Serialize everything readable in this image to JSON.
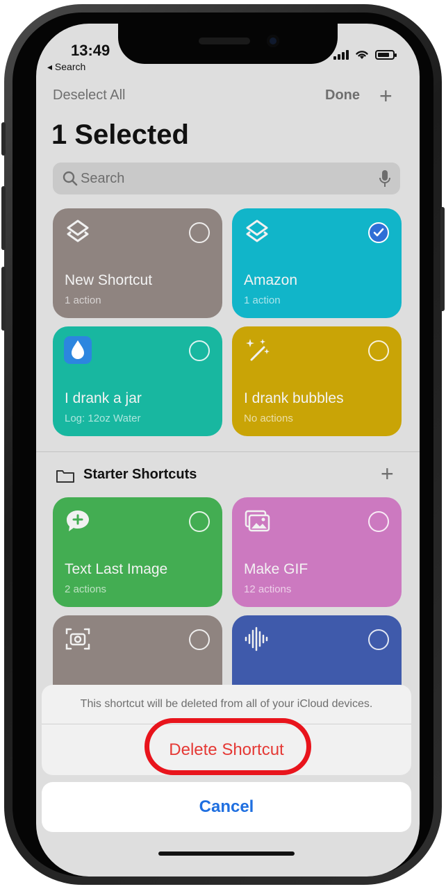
{
  "status": {
    "time": "13:49",
    "back_label": "◂ Search"
  },
  "nav": {
    "deselect_label": "Deselect All",
    "done_label": "Done",
    "add_label": "+"
  },
  "page_title": "1 Selected",
  "search": {
    "placeholder": "Search"
  },
  "shortcuts": [
    {
      "name": "New Shortcut",
      "subtitle": "1 action",
      "color": "#8f8480",
      "icon": "layers-icon",
      "selected": false
    },
    {
      "name": "Amazon",
      "subtitle": "1 action",
      "color": "#11b5c9",
      "icon": "layers-icon",
      "selected": true
    },
    {
      "name": "I drank a jar",
      "subtitle": "Log: 12oz Water",
      "color": "#18b7a0",
      "icon": "water-drop-icon",
      "selected": false
    },
    {
      "name": "I drank bubbles",
      "subtitle": "No actions",
      "color": "#c9a406",
      "icon": "magic-wand-icon",
      "selected": false
    }
  ],
  "starter_section": {
    "label": "Starter Shortcuts",
    "add_label": "+"
  },
  "starter_shortcuts": [
    {
      "name": "Text Last Image",
      "subtitle": "2 actions",
      "color": "#43ad52",
      "icon": "message-plus-icon"
    },
    {
      "name": "Make GIF",
      "subtitle": "12 actions",
      "color": "#cc79c0",
      "icon": "photos-icon"
    },
    {
      "name": "",
      "subtitle": "",
      "color": "#8f8480",
      "icon": "camera-scan-icon"
    },
    {
      "name": "",
      "subtitle": "",
      "color": "#3f5aab",
      "icon": "waveform-icon"
    }
  ],
  "action_sheet": {
    "message": "This shortcut will be deleted from all of your iCloud devices.",
    "delete_label": "Delete Shortcut",
    "cancel_label": "Cancel",
    "delete_color": "#e53935",
    "cancel_color": "#1f6fe0",
    "highlight_color": "#e8141c"
  }
}
